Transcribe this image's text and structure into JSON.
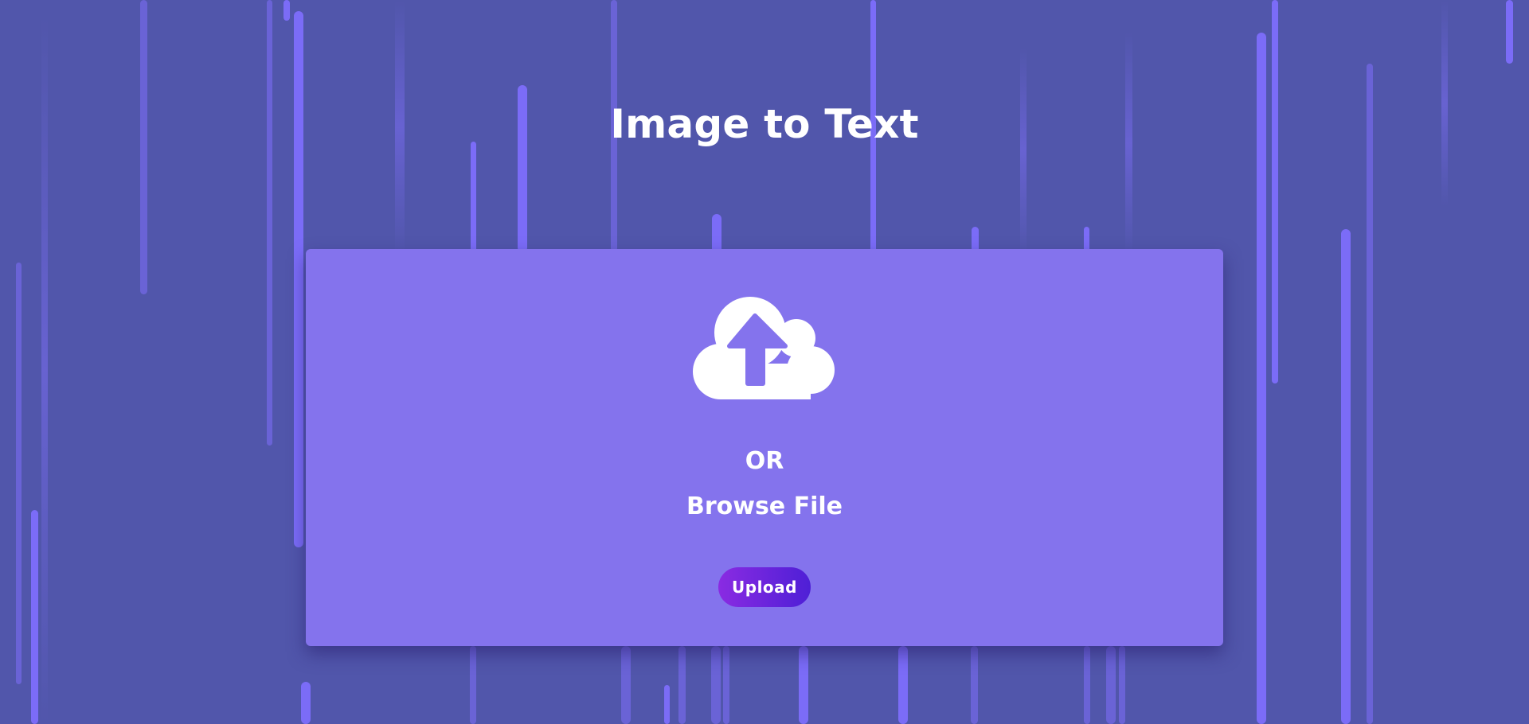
{
  "page": {
    "title": "Image to Text"
  },
  "upload_panel": {
    "or_text": "OR",
    "browse_text": "Browse File",
    "upload_label": "Upload",
    "icon": "cloud-upload-icon"
  },
  "colors": {
    "background": "#5156ab",
    "stripe": "#7b6cf7",
    "panel": "#8473ed",
    "button_gradient_start": "#8a2be2",
    "button_gradient_end": "#4e1fd6",
    "text": "#ffffff"
  }
}
